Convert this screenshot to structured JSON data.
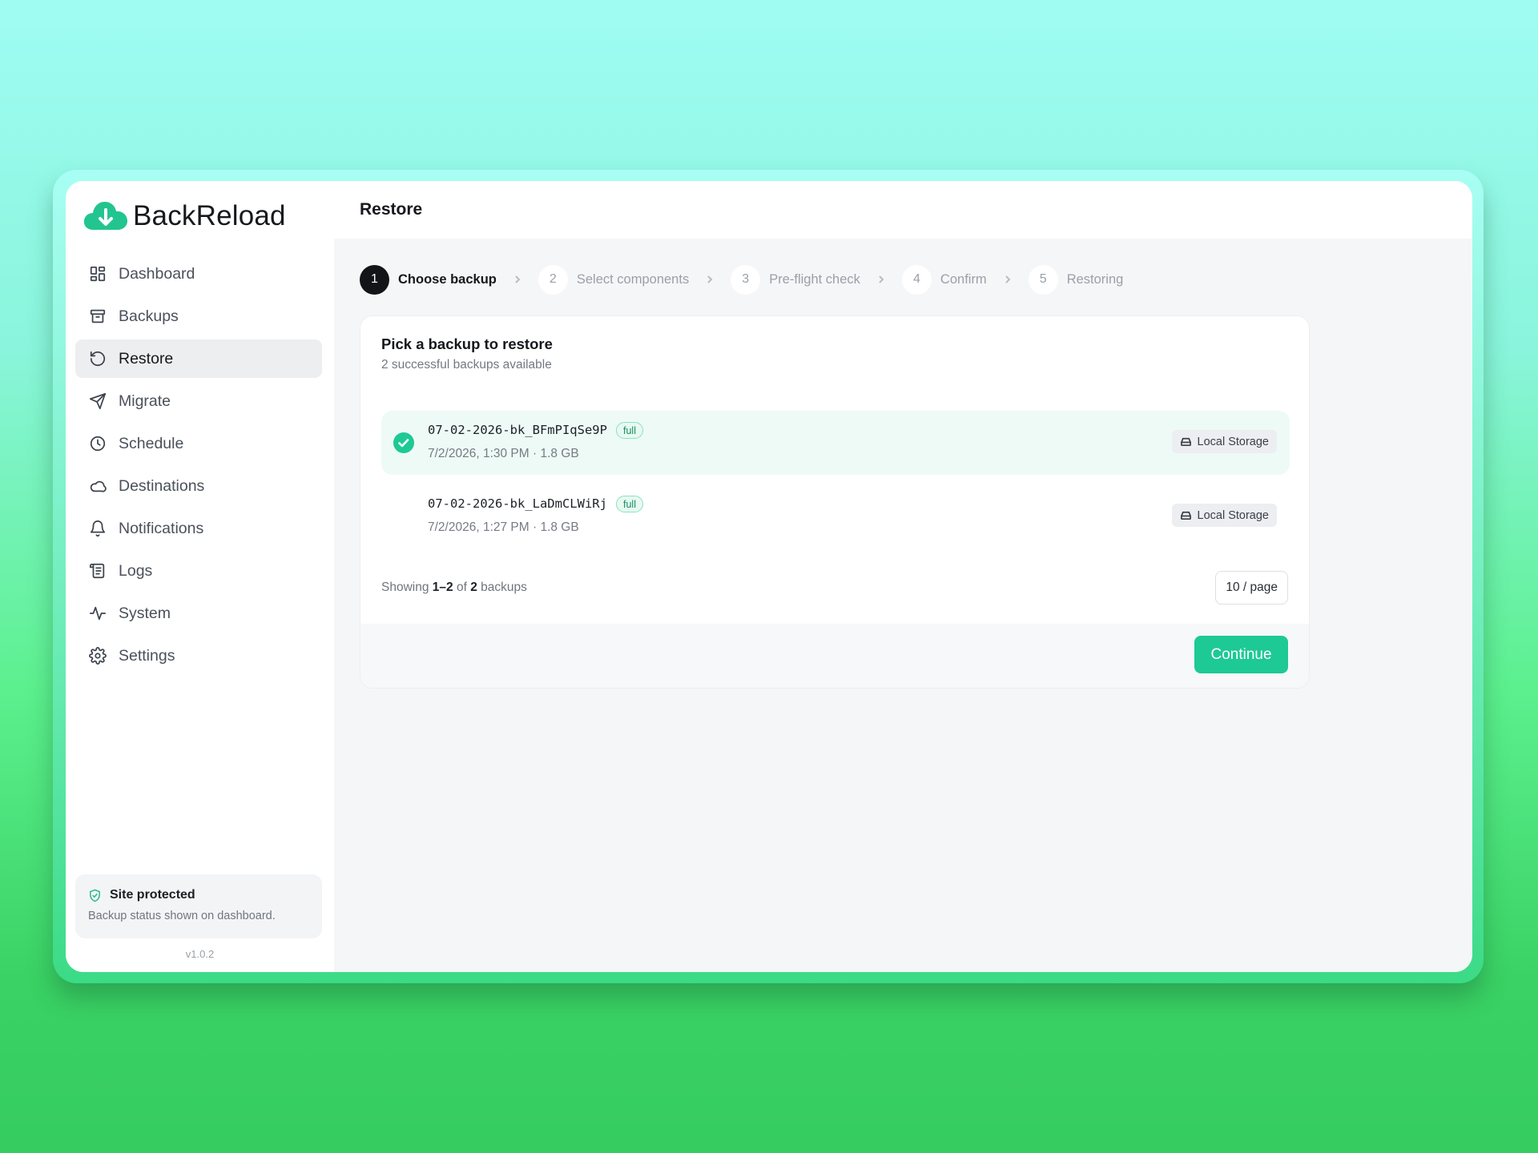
{
  "app": {
    "name": "BackReload",
    "version": "v1.0.2",
    "brand_color": "#1dc995"
  },
  "header": {
    "title": "Restore"
  },
  "sidebar": {
    "items": [
      {
        "label": "Dashboard",
        "icon": "dashboard-icon"
      },
      {
        "label": "Backups",
        "icon": "archive-icon"
      },
      {
        "label": "Restore",
        "icon": "restore-icon",
        "active": true
      },
      {
        "label": "Migrate",
        "icon": "send-icon"
      },
      {
        "label": "Schedule",
        "icon": "clock-icon"
      },
      {
        "label": "Destinations",
        "icon": "cloud-icon"
      },
      {
        "label": "Notifications",
        "icon": "bell-icon"
      },
      {
        "label": "Logs",
        "icon": "scroll-icon"
      },
      {
        "label": "System",
        "icon": "activity-icon"
      },
      {
        "label": "Settings",
        "icon": "gear-icon"
      }
    ],
    "status": {
      "title": "Site protected",
      "subtitle": "Backup status shown on dashboard."
    }
  },
  "stepper": {
    "steps": [
      {
        "num": "1",
        "label": "Choose backup",
        "active": true
      },
      {
        "num": "2",
        "label": "Select components"
      },
      {
        "num": "3",
        "label": "Pre-flight check"
      },
      {
        "num": "4",
        "label": "Confirm"
      },
      {
        "num": "5",
        "label": "Restoring"
      }
    ]
  },
  "card": {
    "title": "Pick a backup to restore",
    "subtitle": "2 successful backups available",
    "backups": [
      {
        "name": "07-02-2026-bk_BFmPIqSe9P",
        "type": "full",
        "meta": "7/2/2026, 1:30 PM · 1.8 GB",
        "destination": "Local Storage",
        "selected": true
      },
      {
        "name": "07-02-2026-bk_LaDmCLWiRj",
        "type": "full",
        "meta": "7/2/2026, 1:27 PM · 1.8 GB",
        "destination": "Local Storage",
        "selected": false
      }
    ],
    "pagination": {
      "prefix": "Showing",
      "range": "1–2",
      "of": "of",
      "total": "2",
      "suffix": "backups",
      "per_page": "10 / page"
    },
    "continue_label": "Continue"
  }
}
